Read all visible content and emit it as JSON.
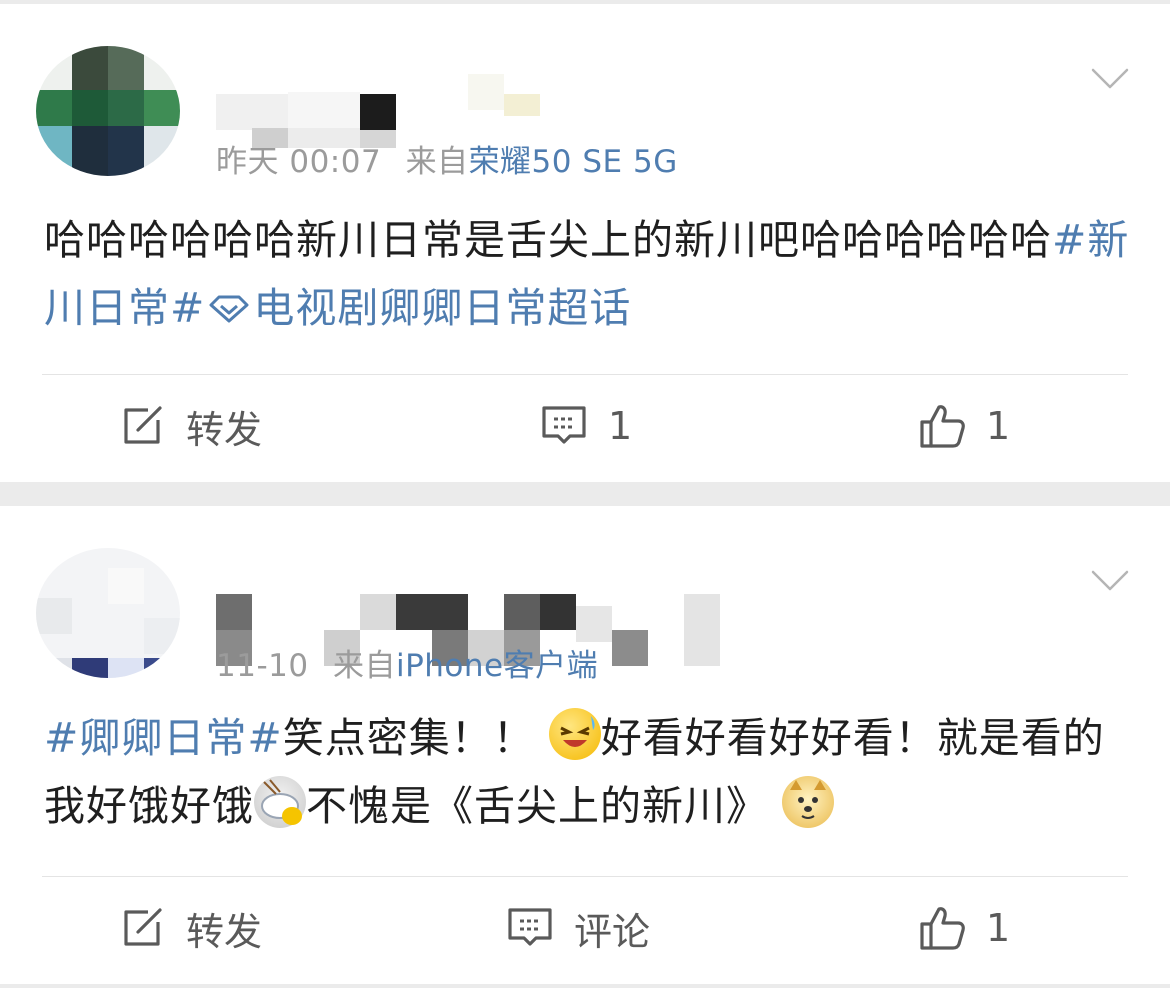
{
  "posts": [
    {
      "time": "昨天 00:07",
      "source_prefix": "来自",
      "source": "荣耀50 SE 5G",
      "text_before": "哈哈哈哈哈哈新川日常是舌尖上的新川吧哈哈哈哈哈哈",
      "hashtag1": "#新川日常#",
      "hashtag2": "电视剧卿卿日常超话",
      "repost_label": "转发",
      "comment_count": "1",
      "like_count": "1"
    },
    {
      "time": "11-10",
      "source_prefix": "来自",
      "source": "iPhone客户端",
      "hashtag": "#卿卿日常#",
      "text_a": "笑点密集！！",
      "text_b": "好看好看好好看！就是看的我好饿好饿",
      "text_c": "不愧是《舌尖上的新川》",
      "repost_label": "转发",
      "comment_label": "评论",
      "like_count": "1"
    }
  ],
  "icons": {
    "repost": "repost-icon",
    "comment": "comment-icon",
    "like": "thumbs-up-icon",
    "more": "chevron-down-icon",
    "supertopic": "diamond-icon"
  },
  "colors": {
    "link": "#4f7db0",
    "meta": "#9b9b9b",
    "text": "#1f1f1f",
    "separator": "#ebebeb"
  }
}
